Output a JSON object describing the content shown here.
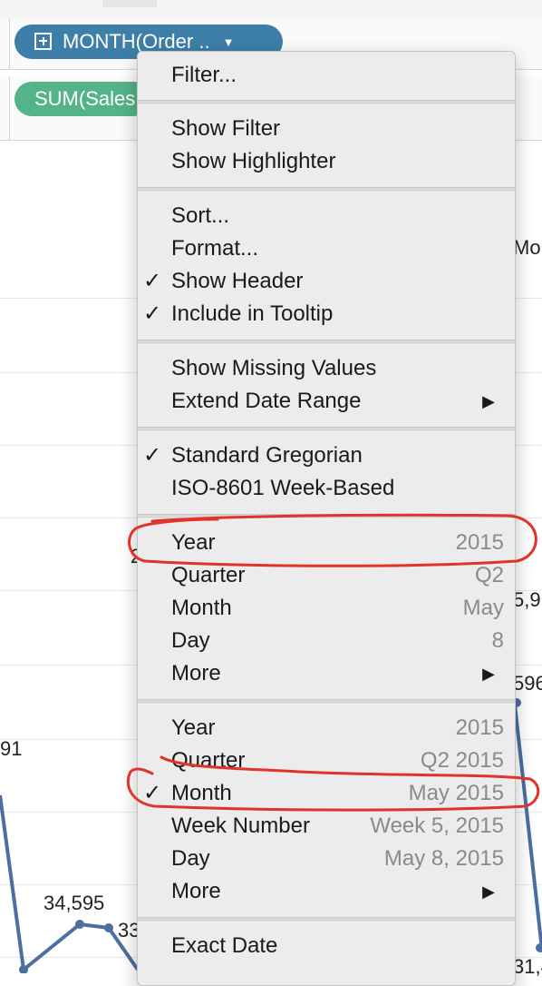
{
  "shelf": {
    "columns_pill": {
      "label": "MONTH(Order .."
    },
    "rows_pill": {
      "label": "SUM(Sales"
    }
  },
  "chart": {
    "edge_text_right": "Mo",
    "data_labels": {
      "left_891": "91",
      "mid_34595": "34,595",
      "mid_33": "33",
      "right_5_9": "5,9",
      "right_596": "596",
      "right_bottom": "31,4",
      "left_edge_2": "2"
    },
    "line_color": "#4a6fa0"
  },
  "menu": {
    "filter": "Filter...",
    "show_filter": "Show Filter",
    "show_highlighter": "Show Highlighter",
    "sort": "Sort...",
    "format": "Format...",
    "show_header": "Show Header",
    "include_tooltip": "Include in Tooltip",
    "show_missing": "Show Missing Values",
    "extend_date": "Extend Date Range",
    "standard_gregorian": "Standard Gregorian",
    "iso_week": "ISO-8601 Week-Based",
    "discrete": [
      {
        "label": "Year",
        "value": "2015"
      },
      {
        "label": "Quarter",
        "value": "Q2"
      },
      {
        "label": "Month",
        "value": "May"
      },
      {
        "label": "Day",
        "value": "8"
      },
      {
        "label": "More",
        "value": ""
      }
    ],
    "continuous": [
      {
        "label": "Year",
        "value": "2015"
      },
      {
        "label": "Quarter",
        "value": "Q2 2015"
      },
      {
        "label": "Month",
        "value": "May 2015"
      },
      {
        "label": "Week Number",
        "value": "Week 5, 2015"
      },
      {
        "label": "Day",
        "value": "May 8, 2015"
      },
      {
        "label": "More",
        "value": ""
      }
    ],
    "exact_date": "Exact Date",
    "checkmark": "✓",
    "submenu_arrow": "▶"
  },
  "annotation_color": "#e0342a"
}
